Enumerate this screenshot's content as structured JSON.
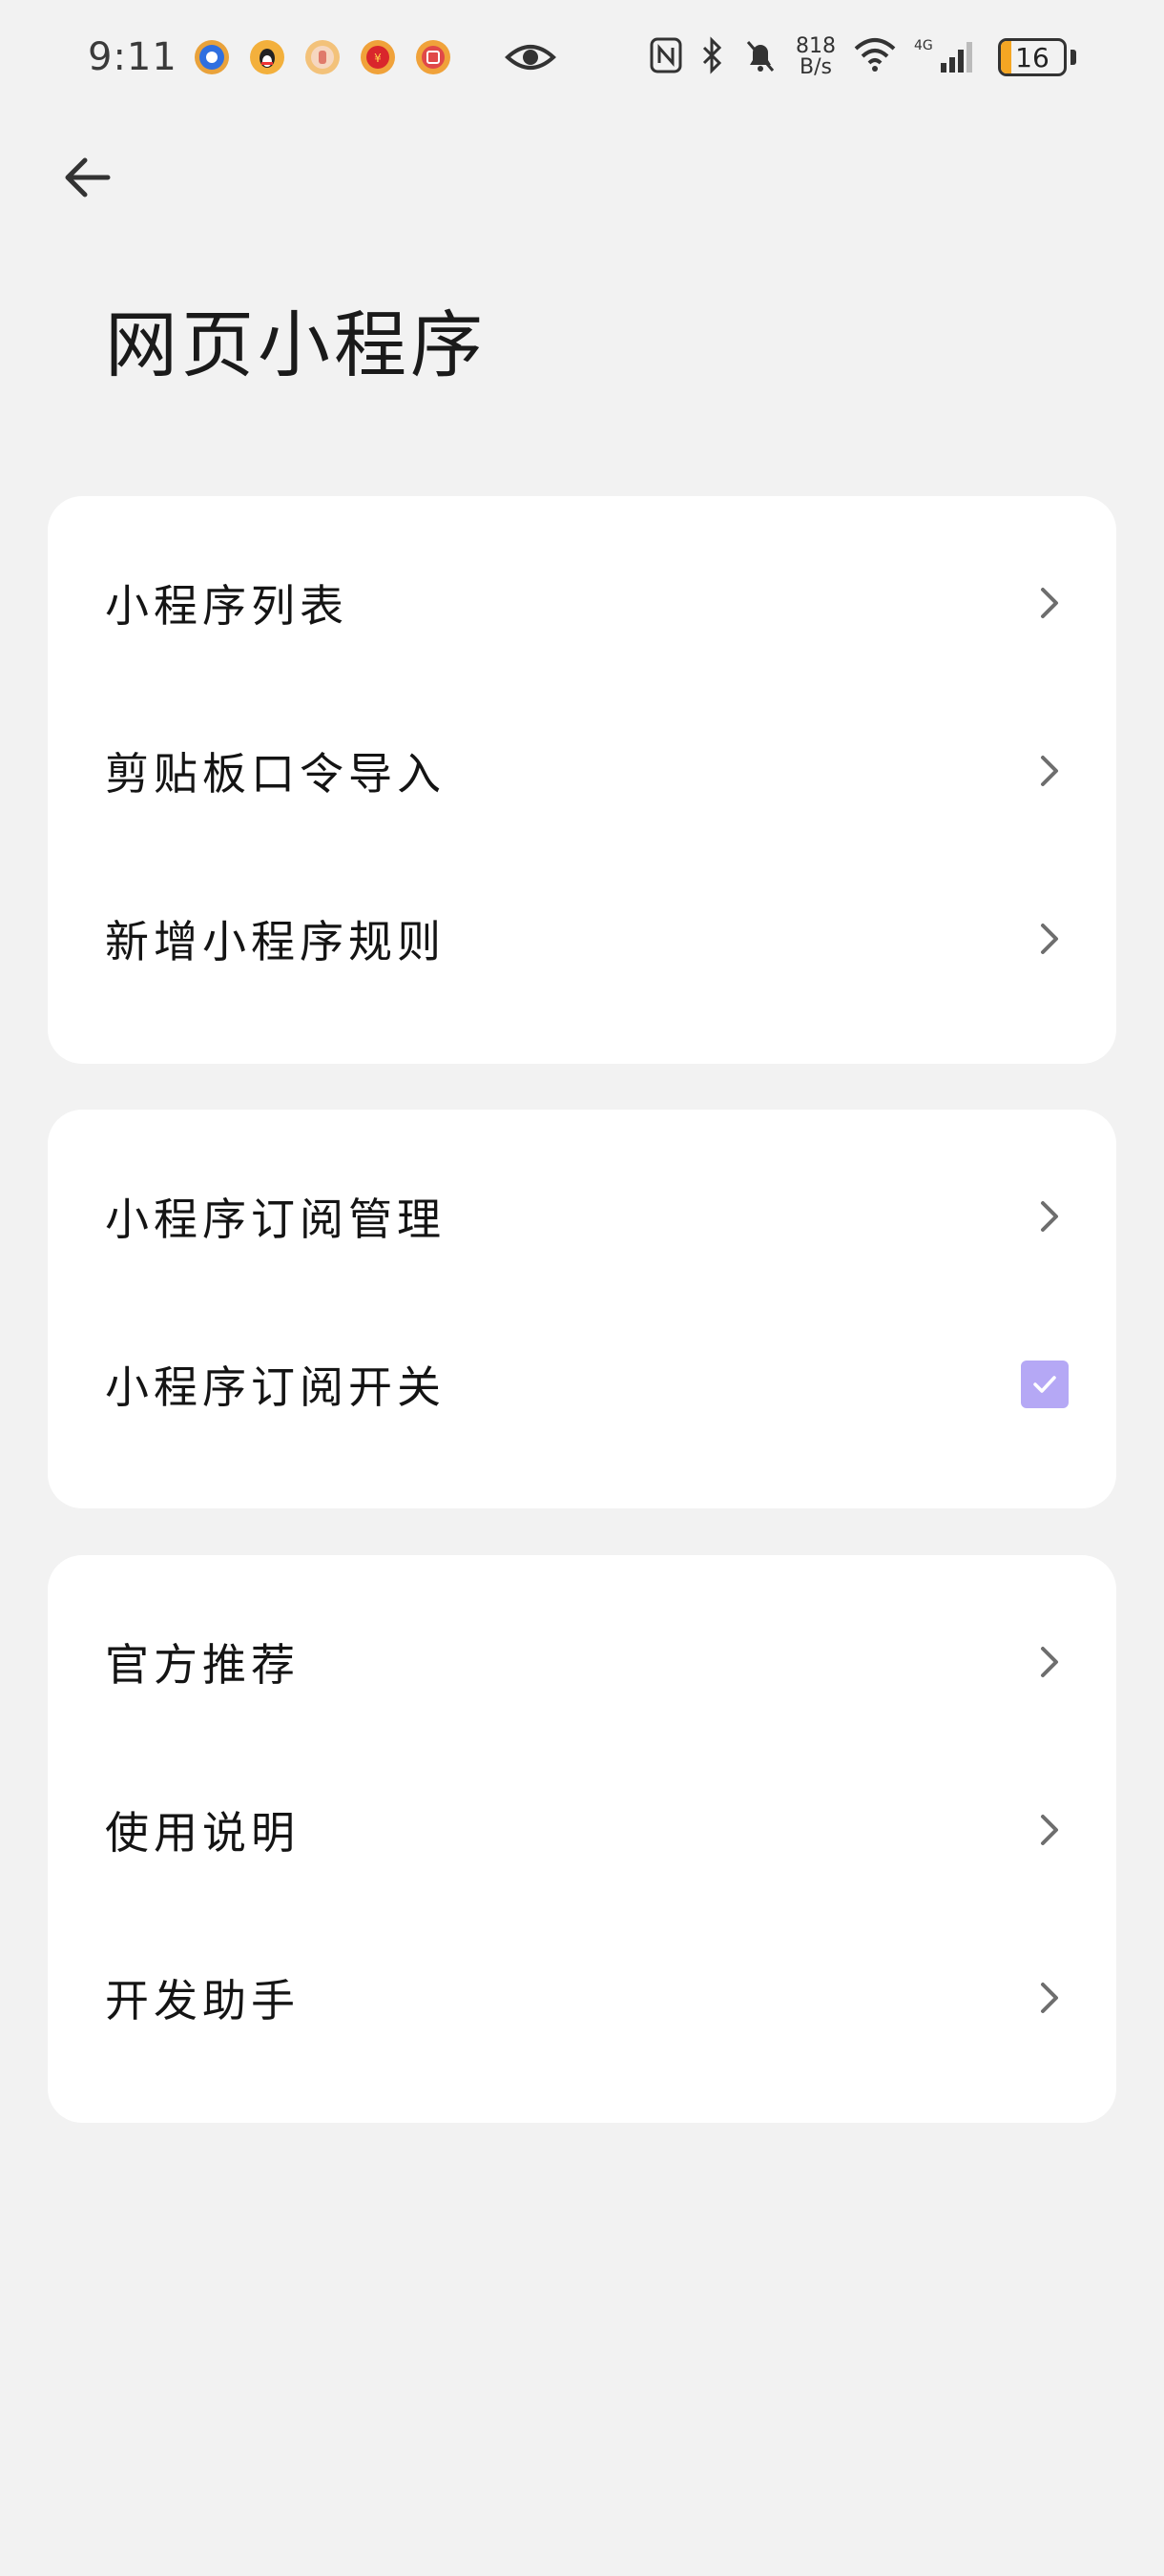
{
  "status_bar": {
    "time": "9:11",
    "notification_icons": [
      "app-notification-blue",
      "qq-penguin",
      "hand-app",
      "red-app-1",
      "red-app-2"
    ],
    "network_speed_value": "818",
    "network_speed_unit": "B/s",
    "battery_level": "16",
    "battery_fraction": 0.16,
    "battery_color": "#f5a623"
  },
  "header": {
    "back_icon": "arrow-left-icon",
    "title": "网页小程序"
  },
  "sections": [
    {
      "items": [
        {
          "label": "小程序列表",
          "control": "chevron"
        },
        {
          "label": "剪贴板口令导入",
          "control": "chevron"
        },
        {
          "label": "新增小程序规则",
          "control": "chevron"
        }
      ]
    },
    {
      "items": [
        {
          "label": "小程序订阅管理",
          "control": "chevron"
        },
        {
          "label": "小程序订阅开关",
          "control": "checkbox",
          "checked": true
        }
      ]
    },
    {
      "items": [
        {
          "label": "官方推荐",
          "control": "chevron"
        },
        {
          "label": "使用说明",
          "control": "chevron"
        },
        {
          "label": "开发助手",
          "control": "chevron"
        }
      ]
    }
  ],
  "colors": {
    "background": "#f2f2f2",
    "card": "#ffffff",
    "checkbox_accent": "#b5a8f5",
    "chevron": "#6e6e6e"
  }
}
